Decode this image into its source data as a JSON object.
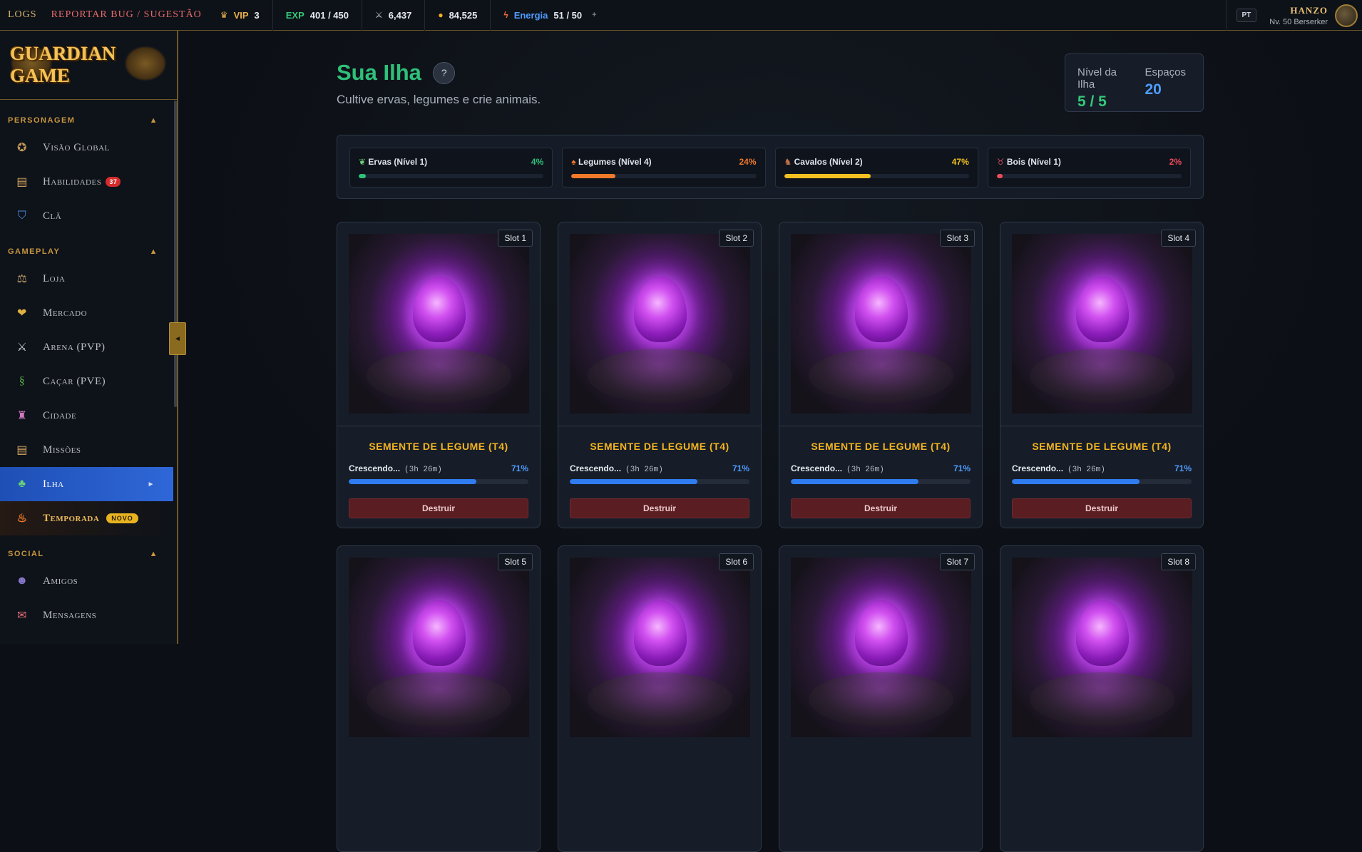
{
  "topbar": {
    "logs": "LOGS",
    "report": "REPORTAR BUG / SUGESTÃO",
    "vip_label": "VIP",
    "vip_value": "3",
    "exp_label": "EXP",
    "exp_value": "401 / 450",
    "power_value": "6,437",
    "gold_value": "84,525",
    "energy_label": "Energia",
    "energy_value": "51 / 50",
    "energy_plus": "+",
    "lang": "PT",
    "username": "HANZO",
    "user_level": "Nv. 50 Berserker",
    "icons": {
      "vip": "crown-icon",
      "power": "crossed-swords-icon",
      "gold": "coin-icon",
      "energy": "bolt-icon"
    },
    "colors": {
      "vip": "#e8b04a",
      "exp": "#34c878",
      "energy": "#4f9cff"
    }
  },
  "sidebar": {
    "logo": "GUARDIAN GAME",
    "sections": [
      {
        "title": "PERSONAGEM",
        "toggle": "▲",
        "items": [
          {
            "label": "Visão Global",
            "icon": "compass-icon"
          },
          {
            "label": "Habilidades",
            "icon": "scroll-icon",
            "badge": "37"
          },
          {
            "label": "Clã",
            "icon": "shield-icon"
          }
        ]
      },
      {
        "title": "GAMEPLAY",
        "toggle": "▲",
        "items": [
          {
            "label": "Loja",
            "icon": "scales-icon"
          },
          {
            "label": "Mercado",
            "icon": "coin-bag-icon"
          },
          {
            "label": "Arena (PVP)",
            "icon": "swords-icon"
          },
          {
            "label": "Caçar (PVE)",
            "icon": "dragon-icon"
          },
          {
            "label": "Cidade",
            "icon": "castle-icon"
          },
          {
            "label": "Missões",
            "icon": "scroll-icon"
          },
          {
            "label": "Ilha",
            "icon": "island-icon",
            "active": true,
            "arrow": "►"
          },
          {
            "label": "Temporada",
            "icon": "fire-icon",
            "badge_new": "NOVO"
          }
        ]
      },
      {
        "title": "SOCIAL",
        "toggle": "▲",
        "items": [
          {
            "label": "Amigos",
            "icon": "people-icon"
          },
          {
            "label": "Mensagens",
            "icon": "inbox-icon"
          }
        ]
      }
    ],
    "collapse": "◄"
  },
  "main": {
    "title": "Sua Ilha",
    "help": "?",
    "subtitle": "Cultive ervas, legumes e crie animais.",
    "island_level_label": "Nível da Ilha",
    "island_level_value": "5 / 5",
    "spaces_label": "Espaços",
    "spaces_value": "20",
    "colors": {
      "title": "#2fc07a",
      "level": "#34c878",
      "spaces": "#4f9cff"
    },
    "skills": [
      {
        "name": "Ervas (Nível 1)",
        "percent": "4%",
        "value": 4,
        "icon": "herb-icon",
        "color": "#2fc07a"
      },
      {
        "name": "Legumes (Nível 4)",
        "percent": "24%",
        "value": 24,
        "icon": "carrot-icon",
        "color": "#f2782a"
      },
      {
        "name": "Cavalos (Nível 2)",
        "percent": "47%",
        "value": 47,
        "icon": "horse-icon",
        "color": "#f2c020"
      },
      {
        "name": "Bois (Nível 1)",
        "percent": "2%",
        "value": 2,
        "icon": "ox-icon",
        "color": "#f24a5a"
      }
    ],
    "slots": [
      {
        "tag": "Slot 1",
        "name": "SEMENTE DE LEGUME (T4)",
        "status": "Crescendo...",
        "time": "(3h 26m)",
        "percent": "71%",
        "value": 71,
        "button": "Destruir"
      },
      {
        "tag": "Slot 2",
        "name": "SEMENTE DE LEGUME (T4)",
        "status": "Crescendo...",
        "time": "(3h 26m)",
        "percent": "71%",
        "value": 71,
        "button": "Destruir"
      },
      {
        "tag": "Slot 3",
        "name": "SEMENTE DE LEGUME (T4)",
        "status": "Crescendo...",
        "time": "(3h 26m)",
        "percent": "71%",
        "value": 71,
        "button": "Destruir"
      },
      {
        "tag": "Slot 4",
        "name": "SEMENTE DE LEGUME (T4)",
        "status": "Crescendo...",
        "time": "(3h 26m)",
        "percent": "71%",
        "value": 71,
        "button": "Destruir"
      },
      {
        "tag": "Slot 5"
      },
      {
        "tag": "Slot 6"
      },
      {
        "tag": "Slot 7"
      },
      {
        "tag": "Slot 8"
      }
    ]
  }
}
